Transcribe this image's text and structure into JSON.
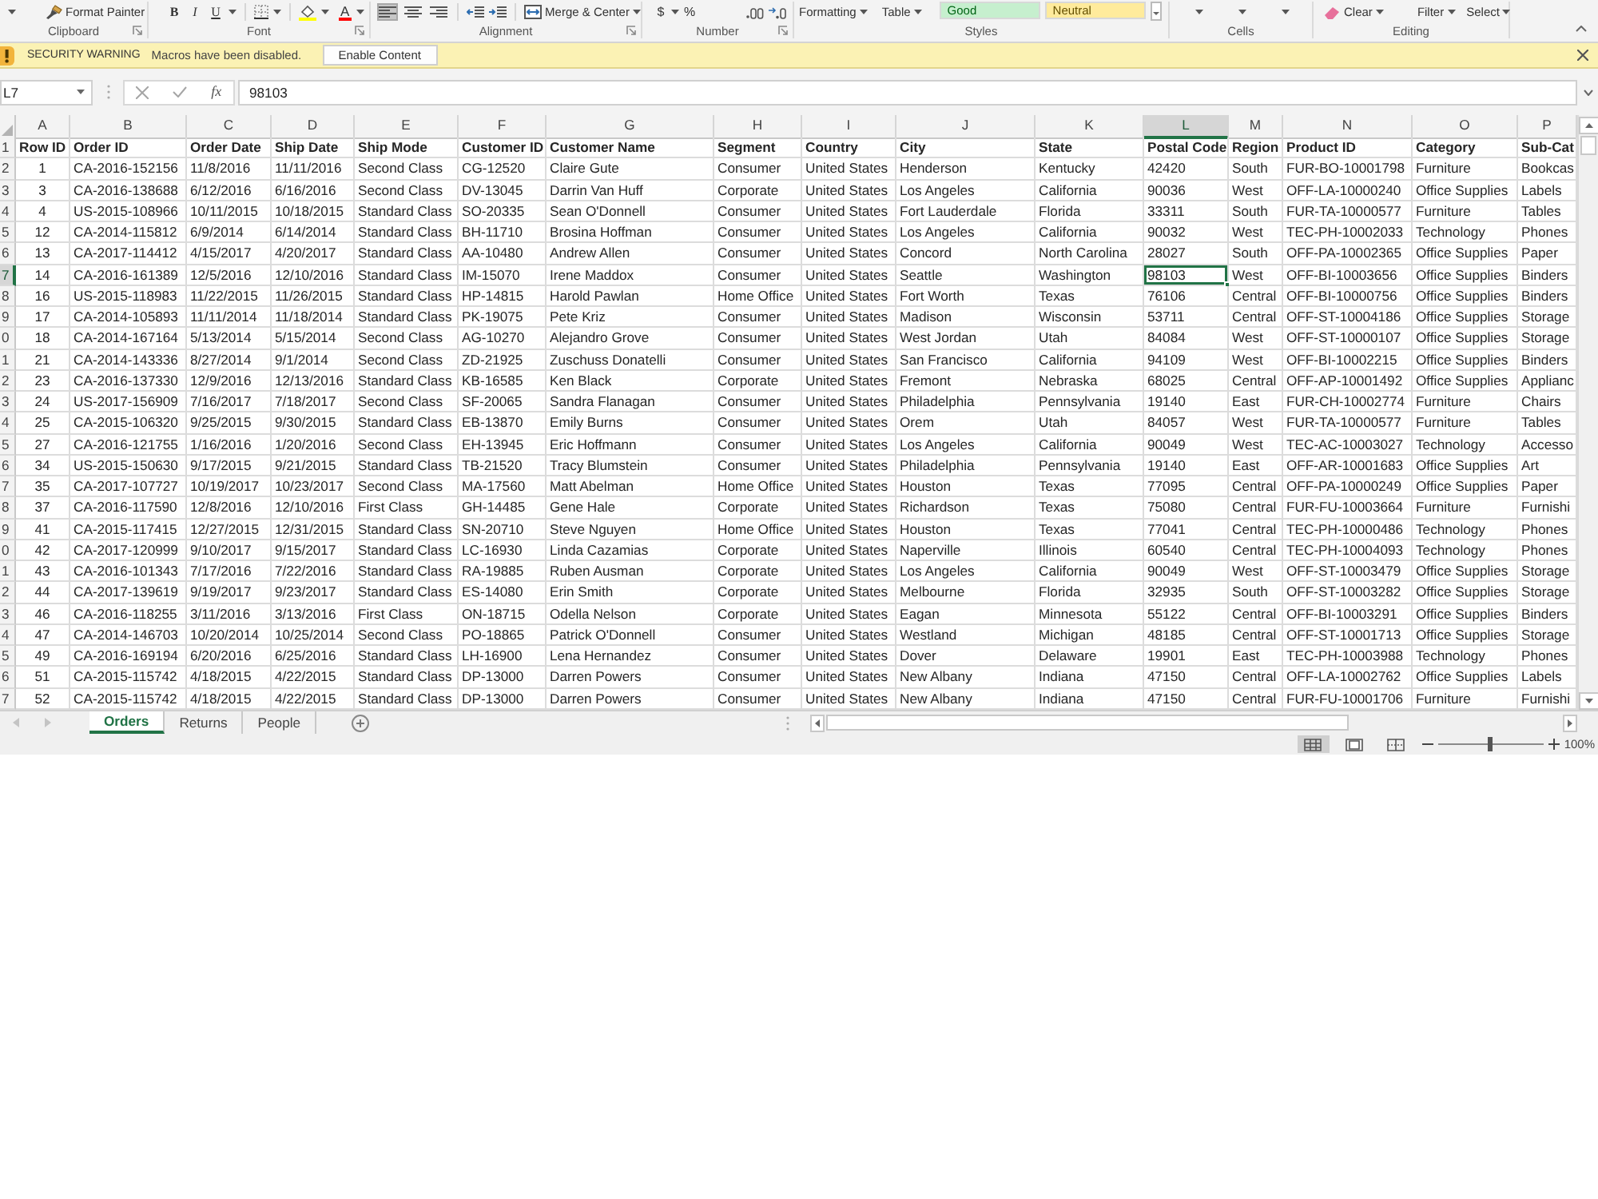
{
  "ribbon": {
    "format_painter": "Format Painter",
    "font_buttons": [
      "B",
      "I",
      "U"
    ],
    "font_color_button": "A",
    "alignment": [
      {
        "selected": true
      },
      {
        "selected": false
      },
      {
        "selected": false
      }
    ],
    "merge_center": "Merge & Center",
    "number_buttons": [
      "$",
      "%"
    ],
    "conditional_formatting": "Formatting",
    "format_as_table": "Table",
    "cell_styles": [
      {
        "label": "Good",
        "color": "#c6efce"
      },
      {
        "label": "Neutral",
        "color": "#ffeb9c"
      }
    ],
    "clear": "Clear",
    "sort_filter": "Filter",
    "find_select": "Select",
    "group_labels": [
      "Clipboard",
      "Font",
      "Alignment",
      "Number",
      "Styles",
      "Cells",
      "Editing"
    ]
  },
  "security_bar": {
    "title": "SECURITY WARNING",
    "message": "Macros have been disabled.",
    "button": "Enable Content"
  },
  "formula_bar": {
    "name_box": "L7",
    "function_button": "fx",
    "value": "98103"
  },
  "sheet": {
    "columns": [
      {
        "letter": "A",
        "selected": false
      },
      {
        "letter": "B",
        "selected": false
      },
      {
        "letter": "C",
        "selected": false
      },
      {
        "letter": "D",
        "selected": false
      },
      {
        "letter": "E",
        "selected": false
      },
      {
        "letter": "F",
        "selected": false
      },
      {
        "letter": "G",
        "selected": false
      },
      {
        "letter": "H",
        "selected": false
      },
      {
        "letter": "I",
        "selected": false
      },
      {
        "letter": "J",
        "selected": false
      },
      {
        "letter": "K",
        "selected": false
      },
      {
        "letter": "L",
        "selected": true
      },
      {
        "letter": "M",
        "selected": false
      },
      {
        "letter": "N",
        "selected": false
      },
      {
        "letter": "O",
        "selected": false
      },
      {
        "letter": "P",
        "selected": false
      }
    ],
    "header_row": {
      "number": "1",
      "selected": false,
      "cells": [
        "Row ID",
        "Order ID",
        "Order Date",
        "Ship Date",
        "Ship Mode",
        "Customer ID",
        "Customer Name",
        "Segment",
        "Country",
        "City",
        "State",
        "Postal Code",
        "Region",
        "Product ID",
        "Category",
        "Sub-Cat"
      ]
    },
    "rows": [
      {
        "number": "2",
        "selected": false,
        "cells": [
          "1",
          "CA-2016-152156",
          "11/8/2016",
          "11/11/2016",
          "Second Class",
          "CG-12520",
          "Claire Gute",
          "Consumer",
          "United States",
          "Henderson",
          "Kentucky",
          "42420",
          "South",
          "FUR-BO-10001798",
          "Furniture",
          "Bookcas"
        ]
      },
      {
        "number": "3",
        "selected": false,
        "cells": [
          "3",
          "CA-2016-138688",
          "6/12/2016",
          "6/16/2016",
          "Second Class",
          "DV-13045",
          "Darrin Van Huff",
          "Corporate",
          "United States",
          "Los Angeles",
          "California",
          "90036",
          "West",
          "OFF-LA-10000240",
          "Office Supplies",
          "Labels"
        ]
      },
      {
        "number": "4",
        "selected": false,
        "cells": [
          "4",
          "US-2015-108966",
          "10/11/2015",
          "10/18/2015",
          "Standard Class",
          "SO-20335",
          "Sean O'Donnell",
          "Consumer",
          "United States",
          "Fort Lauderdale",
          "Florida",
          "33311",
          "South",
          "FUR-TA-10000577",
          "Furniture",
          "Tables"
        ]
      },
      {
        "number": "5",
        "selected": false,
        "cells": [
          "12",
          "CA-2014-115812",
          "6/9/2014",
          "6/14/2014",
          "Standard Class",
          "BH-11710",
          "Brosina Hoffman",
          "Consumer",
          "United States",
          "Los Angeles",
          "California",
          "90032",
          "West",
          "TEC-PH-10002033",
          "Technology",
          "Phones"
        ]
      },
      {
        "number": "6",
        "selected": false,
        "cells": [
          "13",
          "CA-2017-114412",
          "4/15/2017",
          "4/20/2017",
          "Standard Class",
          "AA-10480",
          "Andrew Allen",
          "Consumer",
          "United States",
          "Concord",
          "North Carolina",
          "28027",
          "South",
          "OFF-PA-10002365",
          "Office Supplies",
          "Paper"
        ]
      },
      {
        "number": "7",
        "selected": true,
        "cells": [
          "14",
          "CA-2016-161389",
          "12/5/2016",
          "12/10/2016",
          "Standard Class",
          "IM-15070",
          "Irene Maddox",
          "Consumer",
          "United States",
          "Seattle",
          "Washington",
          "98103",
          "West",
          "OFF-BI-10003656",
          "Office Supplies",
          "Binders"
        ]
      },
      {
        "number": "8",
        "selected": false,
        "cells": [
          "16",
          "US-2015-118983",
          "11/22/2015",
          "11/26/2015",
          "Standard Class",
          "HP-14815",
          "Harold Pawlan",
          "Home Office",
          "United States",
          "Fort Worth",
          "Texas",
          "76106",
          "Central",
          "OFF-BI-10000756",
          "Office Supplies",
          "Binders"
        ]
      },
      {
        "number": "9",
        "selected": false,
        "cells": [
          "17",
          "CA-2014-105893",
          "11/11/2014",
          "11/18/2014",
          "Standard Class",
          "PK-19075",
          "Pete Kriz",
          "Consumer",
          "United States",
          "Madison",
          "Wisconsin",
          "53711",
          "Central",
          "OFF-ST-10004186",
          "Office Supplies",
          "Storage"
        ]
      },
      {
        "number": "0",
        "selected": false,
        "cells": [
          "18",
          "CA-2014-167164",
          "5/13/2014",
          "5/15/2014",
          "Second Class",
          "AG-10270",
          "Alejandro Grove",
          "Consumer",
          "United States",
          "West Jordan",
          "Utah",
          "84084",
          "West",
          "OFF-ST-10000107",
          "Office Supplies",
          "Storage"
        ]
      },
      {
        "number": "1",
        "selected": false,
        "cells": [
          "21",
          "CA-2014-143336",
          "8/27/2014",
          "9/1/2014",
          "Second Class",
          "ZD-21925",
          "Zuschuss Donatelli",
          "Consumer",
          "United States",
          "San Francisco",
          "California",
          "94109",
          "West",
          "OFF-BI-10002215",
          "Office Supplies",
          "Binders"
        ]
      },
      {
        "number": "2",
        "selected": false,
        "cells": [
          "23",
          "CA-2016-137330",
          "12/9/2016",
          "12/13/2016",
          "Standard Class",
          "KB-16585",
          "Ken Black",
          "Corporate",
          "United States",
          "Fremont",
          "Nebraska",
          "68025",
          "Central",
          "OFF-AP-10001492",
          "Office Supplies",
          "Applianc"
        ]
      },
      {
        "number": "3",
        "selected": false,
        "cells": [
          "24",
          "US-2017-156909",
          "7/16/2017",
          "7/18/2017",
          "Second Class",
          "SF-20065",
          "Sandra Flanagan",
          "Consumer",
          "United States",
          "Philadelphia",
          "Pennsylvania",
          "19140",
          "East",
          "FUR-CH-10002774",
          "Furniture",
          "Chairs"
        ]
      },
      {
        "number": "4",
        "selected": false,
        "cells": [
          "25",
          "CA-2015-106320",
          "9/25/2015",
          "9/30/2015",
          "Standard Class",
          "EB-13870",
          "Emily Burns",
          "Consumer",
          "United States",
          "Orem",
          "Utah",
          "84057",
          "West",
          "FUR-TA-10000577",
          "Furniture",
          "Tables"
        ]
      },
      {
        "number": "5",
        "selected": false,
        "cells": [
          "27",
          "CA-2016-121755",
          "1/16/2016",
          "1/20/2016",
          "Second Class",
          "EH-13945",
          "Eric Hoffmann",
          "Consumer",
          "United States",
          "Los Angeles",
          "California",
          "90049",
          "West",
          "TEC-AC-10003027",
          "Technology",
          "Accesso"
        ]
      },
      {
        "number": "6",
        "selected": false,
        "cells": [
          "34",
          "US-2015-150630",
          "9/17/2015",
          "9/21/2015",
          "Standard Class",
          "TB-21520",
          "Tracy Blumstein",
          "Consumer",
          "United States",
          "Philadelphia",
          "Pennsylvania",
          "19140",
          "East",
          "OFF-AR-10001683",
          "Office Supplies",
          "Art"
        ]
      },
      {
        "number": "7",
        "selected": false,
        "cells": [
          "35",
          "CA-2017-107727",
          "10/19/2017",
          "10/23/2017",
          "Second Class",
          "MA-17560",
          "Matt Abelman",
          "Home Office",
          "United States",
          "Houston",
          "Texas",
          "77095",
          "Central",
          "OFF-PA-10000249",
          "Office Supplies",
          "Paper"
        ]
      },
      {
        "number": "8",
        "selected": false,
        "cells": [
          "37",
          "CA-2016-117590",
          "12/8/2016",
          "12/10/2016",
          "First Class",
          "GH-14485",
          "Gene Hale",
          "Corporate",
          "United States",
          "Richardson",
          "Texas",
          "75080",
          "Central",
          "FUR-FU-10003664",
          "Furniture",
          "Furnishi"
        ]
      },
      {
        "number": "9",
        "selected": false,
        "cells": [
          "41",
          "CA-2015-117415",
          "12/27/2015",
          "12/31/2015",
          "Standard Class",
          "SN-20710",
          "Steve Nguyen",
          "Home Office",
          "United States",
          "Houston",
          "Texas",
          "77041",
          "Central",
          "TEC-PH-10000486",
          "Technology",
          "Phones"
        ]
      },
      {
        "number": "0",
        "selected": false,
        "cells": [
          "42",
          "CA-2017-120999",
          "9/10/2017",
          "9/15/2017",
          "Standard Class",
          "LC-16930",
          "Linda Cazamias",
          "Corporate",
          "United States",
          "Naperville",
          "Illinois",
          "60540",
          "Central",
          "TEC-PH-10004093",
          "Technology",
          "Phones"
        ]
      },
      {
        "number": "1",
        "selected": false,
        "cells": [
          "43",
          "CA-2016-101343",
          "7/17/2016",
          "7/22/2016",
          "Standard Class",
          "RA-19885",
          "Ruben Ausman",
          "Corporate",
          "United States",
          "Los Angeles",
          "California",
          "90049",
          "West",
          "OFF-ST-10003479",
          "Office Supplies",
          "Storage"
        ]
      },
      {
        "number": "2",
        "selected": false,
        "cells": [
          "44",
          "CA-2017-139619",
          "9/19/2017",
          "9/23/2017",
          "Standard Class",
          "ES-14080",
          "Erin Smith",
          "Corporate",
          "United States",
          "Melbourne",
          "Florida",
          "32935",
          "South",
          "OFF-ST-10003282",
          "Office Supplies",
          "Storage"
        ]
      },
      {
        "number": "3",
        "selected": false,
        "cells": [
          "46",
          "CA-2016-118255",
          "3/11/2016",
          "3/13/2016",
          "First Class",
          "ON-18715",
          "Odella Nelson",
          "Corporate",
          "United States",
          "Eagan",
          "Minnesota",
          "55122",
          "Central",
          "OFF-BI-10003291",
          "Office Supplies",
          "Binders"
        ]
      },
      {
        "number": "4",
        "selected": false,
        "cells": [
          "47",
          "CA-2014-146703",
          "10/20/2014",
          "10/25/2014",
          "Second Class",
          "PO-18865",
          "Patrick O'Donnell",
          "Consumer",
          "United States",
          "Westland",
          "Michigan",
          "48185",
          "Central",
          "OFF-ST-10001713",
          "Office Supplies",
          "Storage"
        ]
      },
      {
        "number": "5",
        "selected": false,
        "cells": [
          "49",
          "CA-2016-169194",
          "6/20/2016",
          "6/25/2016",
          "Standard Class",
          "LH-16900",
          "Lena Hernandez",
          "Consumer",
          "United States",
          "Dover",
          "Delaware",
          "19901",
          "East",
          "TEC-PH-10003988",
          "Technology",
          "Phones"
        ]
      },
      {
        "number": "6",
        "selected": false,
        "cells": [
          "51",
          "CA-2015-115742",
          "4/18/2015",
          "4/22/2015",
          "Standard Class",
          "DP-13000",
          "Darren Powers",
          "Consumer",
          "United States",
          "New Albany",
          "Indiana",
          "47150",
          "Central",
          "OFF-LA-10002762",
          "Office Supplies",
          "Labels"
        ]
      },
      {
        "number": "7",
        "selected": false,
        "cells": [
          "52",
          "CA-2015-115742",
          "4/18/2015",
          "4/22/2015",
          "Standard Class",
          "DP-13000",
          "Darren Powers",
          "Consumer",
          "United States",
          "New Albany",
          "Indiana",
          "47150",
          "Central",
          "FUR-FU-10001706",
          "Furniture",
          "Furnishi"
        ]
      }
    ]
  },
  "sheet_tabs": [
    {
      "label": "Orders",
      "selected": true
    },
    {
      "label": "Returns",
      "selected": false
    },
    {
      "label": "People",
      "selected": false
    }
  ],
  "status_bar": {
    "views": [
      {
        "selected": true
      },
      {
        "selected": false
      },
      {
        "selected": false
      }
    ],
    "zoom": {
      "level": 0.5,
      "reading": "100%"
    }
  }
}
